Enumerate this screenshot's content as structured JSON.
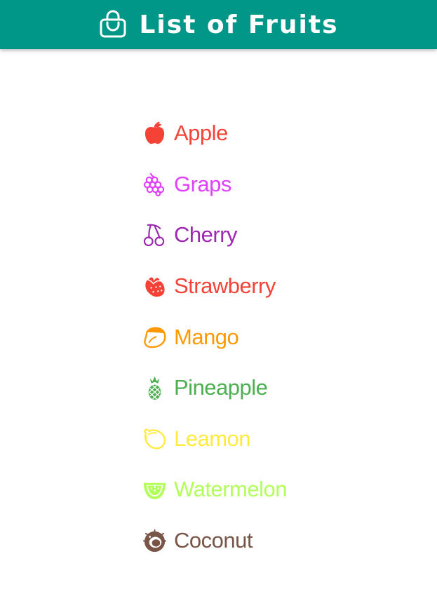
{
  "app_bar": {
    "title": "List of Fruits",
    "icon": "shopping-bag-icon",
    "background": "#009688",
    "title_color": "#ffffff"
  },
  "fruits": [
    {
      "name": "Apple",
      "icon": "apple-icon",
      "color": "#f44336"
    },
    {
      "name": "Graps",
      "icon": "grapes-icon",
      "color": "#e040fb"
    },
    {
      "name": "Cherry",
      "icon": "cherry-icon",
      "color": "#9c27b0"
    },
    {
      "name": "Strawberry",
      "icon": "strawberry-icon",
      "color": "#f44336"
    },
    {
      "name": "Mango",
      "icon": "mango-icon",
      "color": "#ff9800"
    },
    {
      "name": "Pineapple",
      "icon": "pineapple-icon",
      "color": "#4caf50"
    },
    {
      "name": "Leamon",
      "icon": "lemon-icon",
      "color": "#ffeb3b"
    },
    {
      "name": "Watermelon",
      "icon": "watermelon-icon",
      "color": "#b2ff59"
    },
    {
      "name": "Coconut",
      "icon": "coconut-icon",
      "color": "#795548"
    }
  ]
}
